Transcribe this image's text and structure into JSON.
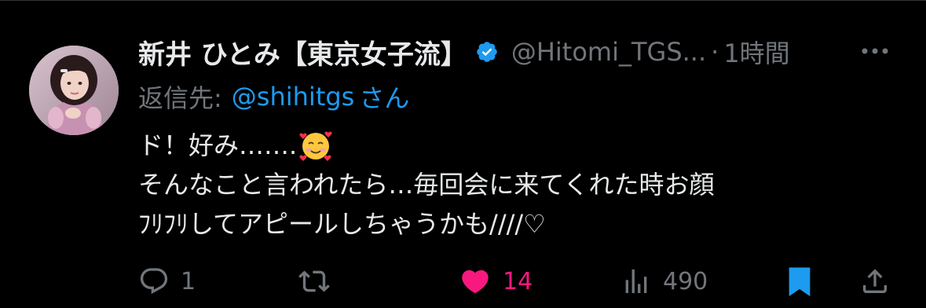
{
  "tweet": {
    "display_name": "新井 ひとみ【東京女子流】",
    "handle": "@Hitomi_TGS...",
    "separator": "·",
    "time": "1時間",
    "reply_prefix": "返信先:",
    "reply_to": "@shihitgs",
    "reply_suffix": "さん",
    "lines": [
      "ド！好み…….",
      "そんなこと言われたら…毎回会に来てくれた時お顔",
      "ﾌﾘﾌﾘしてアピールしちゃうかも////♡"
    ],
    "emoji": "smiling-face-with-hearts"
  },
  "actions": {
    "reply_count": "1",
    "retweet_count": "",
    "like_count": "14",
    "views_count": "490",
    "liked": true,
    "bookmarked": true
  },
  "colors": {
    "background": "#000000",
    "text": "#e7e9ea",
    "secondary": "#71767b",
    "link": "#1d9bf0",
    "like": "#f91880"
  }
}
